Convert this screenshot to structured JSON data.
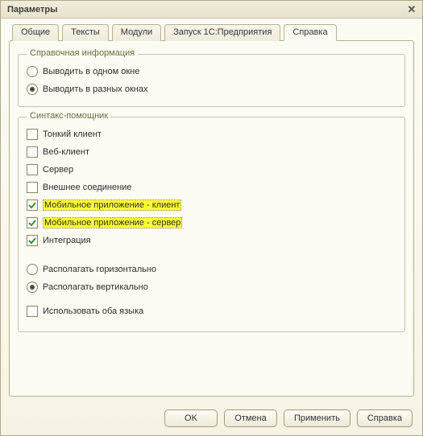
{
  "window": {
    "title": "Параметры"
  },
  "tabs": [
    {
      "label": "Общие"
    },
    {
      "label": "Тексты"
    },
    {
      "label": "Модули"
    },
    {
      "label": "Запуск 1С:Предприятия"
    },
    {
      "label": "Справка"
    }
  ],
  "active_tab_index": 4,
  "group_help": {
    "legend": "Справочная информация",
    "radio_one_window": "Выводить в одном окне",
    "radio_multi_window": "Выводить в разных окнах",
    "selected": "multi"
  },
  "group_syntax": {
    "legend": "Синтакс-помощник",
    "items": [
      {
        "id": "thin-client",
        "label": "Тонкий клиент",
        "checked": false,
        "highlight": false
      },
      {
        "id": "web-client",
        "label": "Веб-клиент",
        "checked": false,
        "highlight": false
      },
      {
        "id": "server",
        "label": "Сервер",
        "checked": false,
        "highlight": false
      },
      {
        "id": "external-connection",
        "label": "Внешнее соединение",
        "checked": false,
        "highlight": false
      },
      {
        "id": "mobile-app-client",
        "label": "Мобильное приложение - клиент",
        "checked": true,
        "highlight": true
      },
      {
        "id": "mobile-app-server",
        "label": "Мобильное приложение - сервер",
        "checked": true,
        "highlight": true
      },
      {
        "id": "integration",
        "label": "Интеграция",
        "checked": true,
        "highlight": false
      }
    ],
    "layout": {
      "horizontal": "Располагать горизонтально",
      "vertical": "Располагать вертикально",
      "selected": "vertical"
    },
    "use_both_languages": {
      "label": "Использовать оба языка",
      "checked": false
    }
  },
  "buttons": {
    "ok": "OK",
    "cancel": "Отмена",
    "apply": "Применить",
    "help": "Справка"
  }
}
